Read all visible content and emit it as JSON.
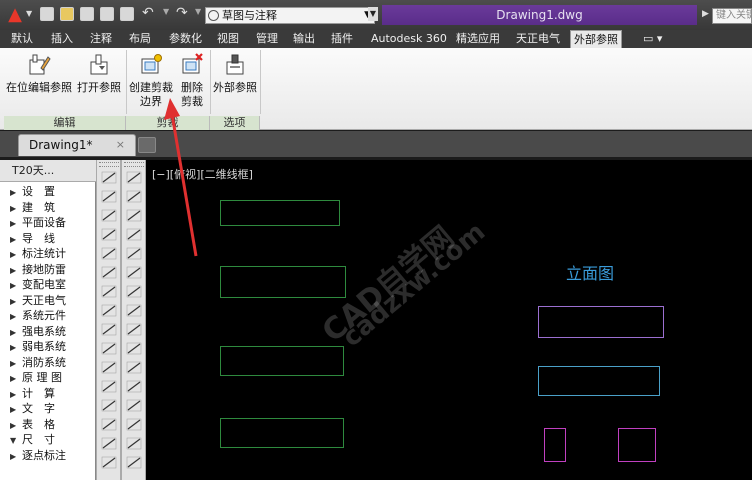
{
  "titlebar": {
    "workspace": "草图与注释",
    "document_title": "Drawing1.dwg",
    "search_placeholder": "键入关键"
  },
  "menu_tabs": [
    "默认",
    "插入",
    "注释",
    "布局",
    "参数化",
    "视图",
    "管理",
    "输出",
    "插件",
    "Autodesk 360",
    "精选应用",
    "天正电气",
    "外部参照"
  ],
  "active_menu_tab": "外部参照",
  "ribbon": {
    "edit_group": {
      "label": "编辑",
      "buttons": [
        {
          "label": "在位编辑参照",
          "icon": "edit-reference-icon"
        },
        {
          "label": "打开参照",
          "icon": "open-reference-icon"
        }
      ]
    },
    "clip_group": {
      "label": "剪裁",
      "buttons": [
        {
          "label": [
            "创建剪裁",
            "边界"
          ],
          "icon": "create-clip-icon"
        },
        {
          "label": [
            "删除",
            "剪裁"
          ],
          "icon": "delete-clip-icon"
        }
      ]
    },
    "options_group": {
      "label": "选项",
      "buttons": [
        {
          "label": "外部参照",
          "icon": "external-reference-icon"
        }
      ]
    }
  },
  "doc_tabs": {
    "active": "Drawing1*",
    "close_glyph": "×"
  },
  "palette": {
    "title": "T20天...",
    "items": [
      "设　置",
      "建　筑",
      "平面设备",
      "导　线",
      "标注统计",
      "接地防雷",
      "变配电室",
      "天正电气",
      "系统元件",
      "强电系统",
      "弱电系统",
      "消防系统",
      "原 理 图",
      "计　算",
      "文　字",
      "表　格",
      "尺　寸",
      "逐点标注"
    ]
  },
  "canvas": {
    "viewport_label": "[−][俯视][二维线框]",
    "elevation_label": "立面图",
    "watermark": [
      "CAD自学网",
      "cadzxw.com"
    ]
  },
  "colors": {
    "accent_purple": "#5a2d8a",
    "group_label_bg": "#d7e4cf",
    "annotation_arrow": "#e03030",
    "elevation_text": "#3a9bd9"
  }
}
